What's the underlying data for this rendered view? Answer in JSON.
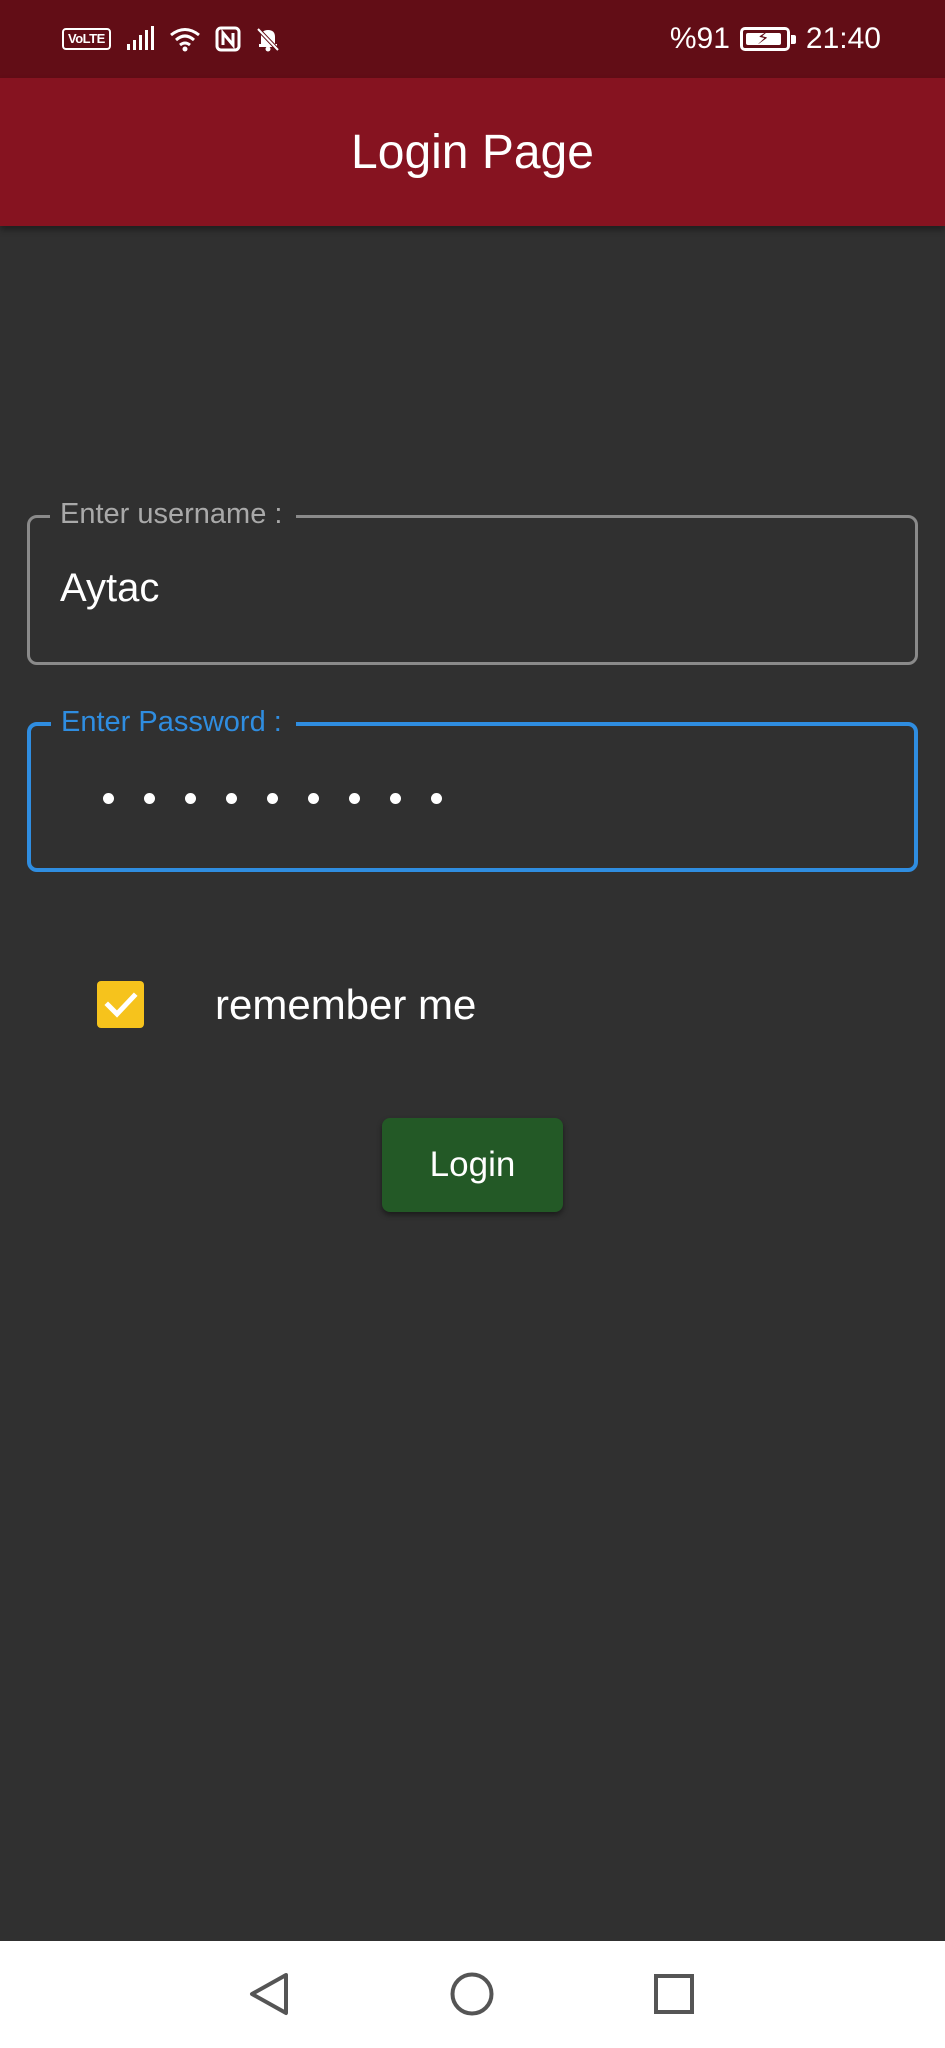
{
  "status_bar": {
    "volte": "VoLTE",
    "battery_text": "%91",
    "battery_level": 0.91,
    "time": "21:40",
    "icons": [
      "signal-icon",
      "wifi-icon",
      "nfc-icon",
      "bell-off-icon",
      "battery-icon"
    ]
  },
  "app_bar": {
    "title": "Login Page",
    "color": "#861320"
  },
  "username": {
    "label": "Enter username :",
    "value": "Aytac"
  },
  "password": {
    "label": "Enter Password :",
    "masked_length": 9,
    "accent": "#2f8de0"
  },
  "remember": {
    "label": "remember me",
    "checked": true,
    "color": "#f6c31c"
  },
  "login_button": {
    "label": "Login",
    "color": "#235926"
  },
  "nav": {
    "icons": [
      "back-icon",
      "home-icon",
      "recents-icon"
    ]
  }
}
